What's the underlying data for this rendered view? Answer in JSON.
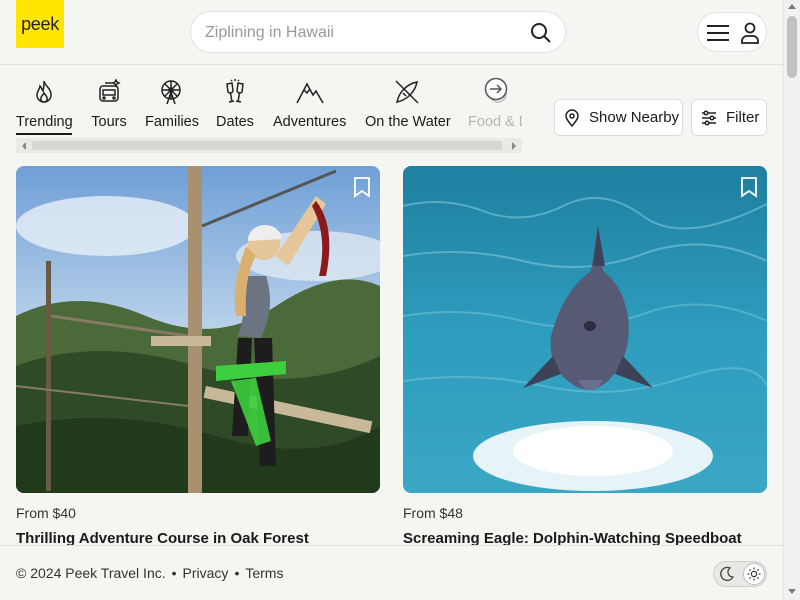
{
  "brand": {
    "logo_text": "peek",
    "accent": "#ffe500"
  },
  "search": {
    "placeholder": "Ziplining in Hawaii"
  },
  "categories": [
    {
      "label": "Trending",
      "icon": "flame-icon",
      "active": true
    },
    {
      "label": "Tours",
      "icon": "bus-icon"
    },
    {
      "label": "Families",
      "icon": "ferris-wheel-icon"
    },
    {
      "label": "Dates",
      "icon": "champagne-icon"
    },
    {
      "label": "Adventures",
      "icon": "mountain-icon"
    },
    {
      "label": "On the Water",
      "icon": "kayak-icon"
    },
    {
      "label": "Food & D",
      "icon": "food-icon",
      "faded": true
    }
  ],
  "actions": {
    "nearby_label": "Show Nearby",
    "filter_label": "Filter"
  },
  "cards": [
    {
      "price": "From $40",
      "title": "Thrilling Adventure Course in Oak Forest",
      "image": "woman-zipline-ropes-course-photo"
    },
    {
      "price": "From $48",
      "title": "Screaming Eagle: Dolphin-Watching Speedboat",
      "image": "dolphin-jumping-ocean-photo"
    }
  ],
  "footer": {
    "copyright": "© 2024 Peek Travel Inc.",
    "privacy": "Privacy",
    "terms": "Terms",
    "sep": "•"
  }
}
